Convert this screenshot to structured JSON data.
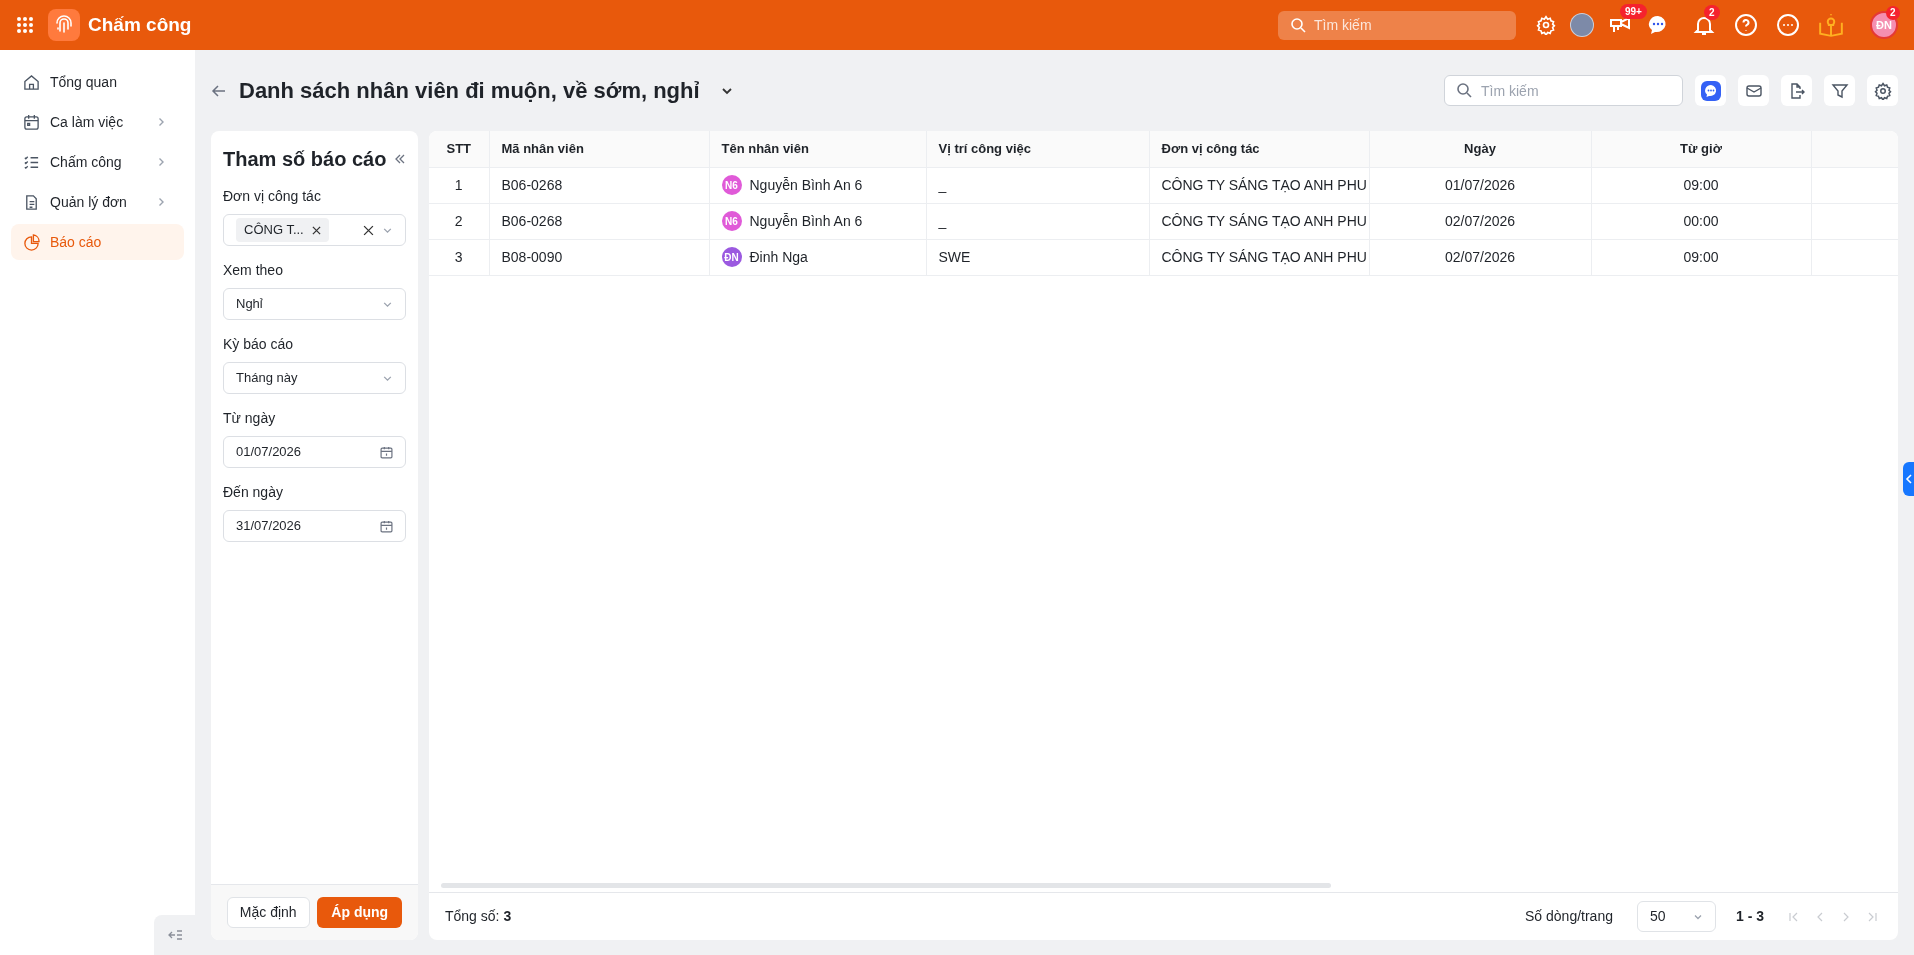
{
  "app": {
    "name": "Chấm công",
    "search_placeholder": "Tìm kiếm",
    "badges": {
      "tasks": "99+",
      "notifications": "2",
      "user": "2"
    },
    "user_initials": "ĐN"
  },
  "sidebar": {
    "items": [
      {
        "label": "Tổng quan",
        "kind": "home",
        "has_children": false,
        "selected": false
      },
      {
        "label": "Ca làm việc",
        "kind": "calendar",
        "has_children": true,
        "selected": false
      },
      {
        "label": "Chấm công",
        "kind": "checklist",
        "has_children": true,
        "selected": false
      },
      {
        "label": "Quản lý đơn",
        "kind": "document",
        "has_children": true,
        "selected": false
      },
      {
        "label": "Báo cáo",
        "kind": "chart",
        "has_children": false,
        "selected": true
      }
    ]
  },
  "page": {
    "title": "Danh sách nhân viên đi muộn, về sớm, nghỉ",
    "search_placeholder": "Tìm kiếm"
  },
  "params": {
    "title": "Tham số báo cáo",
    "fields": [
      {
        "label": "Đơn vị công tác",
        "kind": "tags",
        "tags": [
          "CÔNG T..."
        ]
      },
      {
        "label": "Xem theo",
        "kind": "select",
        "value": "Nghỉ"
      },
      {
        "label": "Kỳ báo cáo",
        "kind": "select",
        "value": "Tháng này"
      },
      {
        "label": "Từ ngày",
        "kind": "date",
        "value": "01/07/2026"
      },
      {
        "label": "Đến ngày",
        "kind": "date",
        "value": "31/07/2026"
      }
    ],
    "buttons": [
      {
        "label": "Mặc định",
        "kind": "secondary"
      },
      {
        "label": "Áp dụng",
        "kind": "primary"
      }
    ]
  },
  "table": {
    "columns": [
      "STT",
      "Mã nhân viên",
      "Tên nhân viên",
      "Vị trí công việc",
      "Đơn vị công tác",
      "Ngày",
      "Từ giờ"
    ],
    "rows": [
      {
        "stt": "1",
        "code": "B06-0268",
        "initials": "N6",
        "color": "#e05ad8",
        "name": "Nguyễn Bình An 6",
        "position": "_",
        "unit": "CÔNG TY SÁNG TẠO ANH PHU",
        "date": "01/07/2026",
        "from": "09:00"
      },
      {
        "stt": "2",
        "code": "B06-0268",
        "initials": "N6",
        "color": "#e05ad8",
        "name": "Nguyễn Bình An 6",
        "position": "_",
        "unit": "CÔNG TY SÁNG TẠO ANH PHU",
        "date": "02/07/2026",
        "from": "00:00"
      },
      {
        "stt": "3",
        "code": "B08-0090",
        "initials": "ĐN",
        "color": "#9b59e0",
        "name": "Đinh Nga",
        "position": "SWE",
        "unit": "CÔNG TY SÁNG TẠO ANH PHU",
        "date": "02/07/2026",
        "from": "09:00"
      }
    ]
  },
  "footer": {
    "total": "Tổng số: **3**",
    "rows_per_page_label": "Số dòng/trang",
    "rows_per_page": "50",
    "range": "1 - 3",
    "nav": [
      {
        "kind": "first",
        "disabled": true
      },
      {
        "kind": "prev",
        "disabled": true
      },
      {
        "kind": "next",
        "disabled": true
      },
      {
        "kind": "last",
        "disabled": true
      }
    ]
  }
}
